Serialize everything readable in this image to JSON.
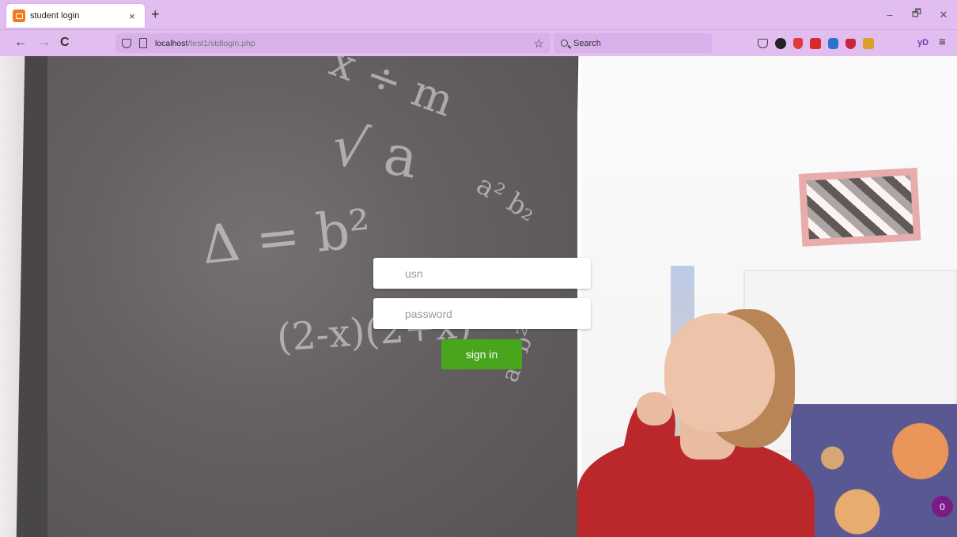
{
  "browser": {
    "tab_title": "student login",
    "tab_close": "×",
    "new_tab": "+",
    "url_host": "localhost",
    "url_path": "/test1/stdlogin.php",
    "search_placeholder": "Search",
    "profile_text": "yD",
    "menu_glyph": "≡",
    "window": {
      "minimize": "–",
      "restore": "🗗",
      "close": "✕"
    },
    "nav": {
      "back": "←",
      "forward": "→",
      "reload": "C"
    },
    "extensions": [
      "pocket-icon",
      "extension-icon",
      "shield-red-icon",
      "pdf-icon",
      "notify-icon",
      "ublock-icon",
      "key-icon"
    ],
    "theme_color": "#e2bdf0"
  },
  "login": {
    "usn_placeholder": "usn",
    "password_placeholder": "password",
    "signin_label": "sign in",
    "button_color": "#49a51c"
  },
  "badge": {
    "count": "0",
    "color": "#7a1b86"
  }
}
